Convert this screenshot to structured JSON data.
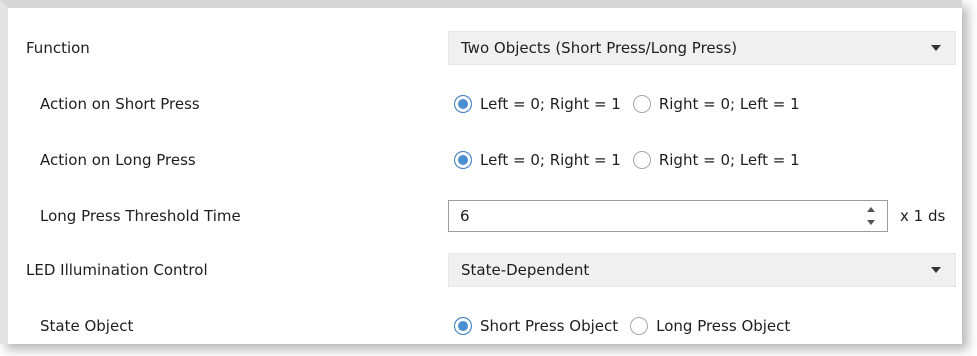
{
  "rows": {
    "function": {
      "label": "Function",
      "value": "Two Objects (Short Press/Long Press)"
    },
    "short_press": {
      "label": "Action on Short Press",
      "options": [
        "Left = 0; Right = 1",
        "Right = 0; Left = 1"
      ],
      "selected": 0
    },
    "long_press": {
      "label": "Action on Long Press",
      "options": [
        "Left = 0; Right = 1",
        "Right = 0; Left = 1"
      ],
      "selected": 0
    },
    "threshold": {
      "label": "Long Press Threshold Time",
      "value": "6",
      "unit": "x 1 ds"
    },
    "led": {
      "label": "LED Illumination Control",
      "value": "State-Dependent"
    },
    "state_object": {
      "label": "State Object",
      "options": [
        "Short Press Object",
        "Long Press Object"
      ],
      "selected": 0
    }
  },
  "colors": {
    "radio_selected": "#4a8fd4",
    "dropdown_bg": "#f0f0f0"
  }
}
